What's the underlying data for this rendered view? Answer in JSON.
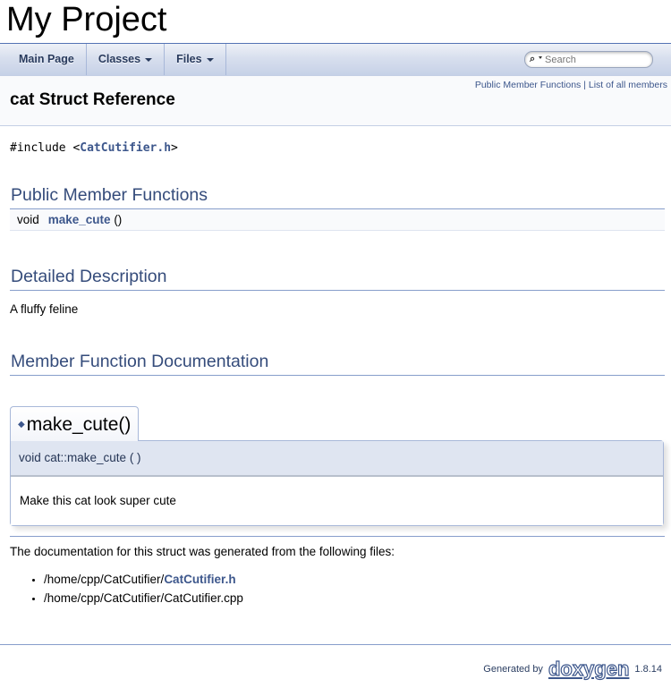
{
  "project": {
    "name": "My Project"
  },
  "nav": {
    "tabs": [
      {
        "label": "Main Page",
        "has_dropdown": false
      },
      {
        "label": "Classes",
        "has_dropdown": true
      },
      {
        "label": "Files",
        "has_dropdown": true
      }
    ],
    "search": {
      "placeholder": "Search",
      "value": ""
    }
  },
  "header": {
    "title": "cat Struct Reference",
    "summary_links": [
      "Public Member Functions",
      "List of all members"
    ],
    "summary_separator": " | "
  },
  "include": {
    "prefix": "#include <",
    "file": "CatCutifier.h",
    "suffix": ">"
  },
  "sections": {
    "public_member_functions": {
      "title": "Public Member Functions",
      "members": [
        {
          "return_type": "void",
          "name": "make_cute",
          "args": " ()"
        }
      ]
    },
    "detailed_description": {
      "title": "Detailed Description",
      "text": "A fluffy feline"
    },
    "member_function_documentation": {
      "title": "Member Function Documentation",
      "items": [
        {
          "title": "make_cute()",
          "prototype": "void cat::make_cute (  )",
          "doc": "Make this cat look super cute"
        }
      ]
    }
  },
  "generated_from": {
    "text": "The documentation for this struct was generated from the following files:",
    "files": [
      {
        "prefix": "/home/cpp/CatCutifier/",
        "name": "CatCutifier.h",
        "linked": true
      },
      {
        "prefix": "/home/cpp/CatCutifier/",
        "name": "CatCutifier.cpp",
        "linked": false
      }
    ]
  },
  "footer": {
    "generated_by": "Generated by",
    "logo_text": "doxygen",
    "version": "1.8.14"
  },
  "colors": {
    "link": "#3D578C",
    "heading": "#354C7B",
    "rule": "#879ECB",
    "proto_bg": "#DFE5F1"
  }
}
